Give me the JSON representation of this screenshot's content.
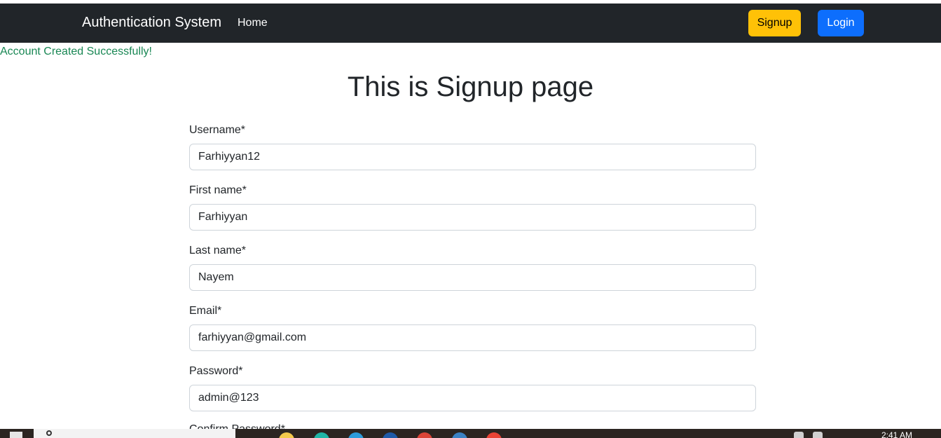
{
  "navbar": {
    "brand": "Authentication System",
    "home_label": "Home",
    "signup_label": "Signup",
    "login_label": "Login",
    "colors": {
      "background": "#212529",
      "signup": "#ffc107",
      "login": "#0d6efd"
    }
  },
  "alert": {
    "message": "Account Created Successfully!",
    "color": "#198754"
  },
  "page": {
    "title": "This is Signup page"
  },
  "form": {
    "fields": [
      {
        "label": "Username*",
        "value": "Farhiyyan12"
      },
      {
        "label": "First name*",
        "value": "Farhiyyan"
      },
      {
        "label": "Last name*",
        "value": "Nayem"
      },
      {
        "label": "Email*",
        "value": "farhiyyan@gmail.com"
      },
      {
        "label": "Password*",
        "value": "admin@123"
      }
    ],
    "partial_label": "Confirm Password*"
  },
  "taskbar": {
    "clock": "2:41 AM",
    "icons": [
      "windows-icon",
      "search-icon",
      "folder-icon",
      "edge-icon",
      "store-icon",
      "vscode-icon",
      "chrome-icon"
    ]
  }
}
